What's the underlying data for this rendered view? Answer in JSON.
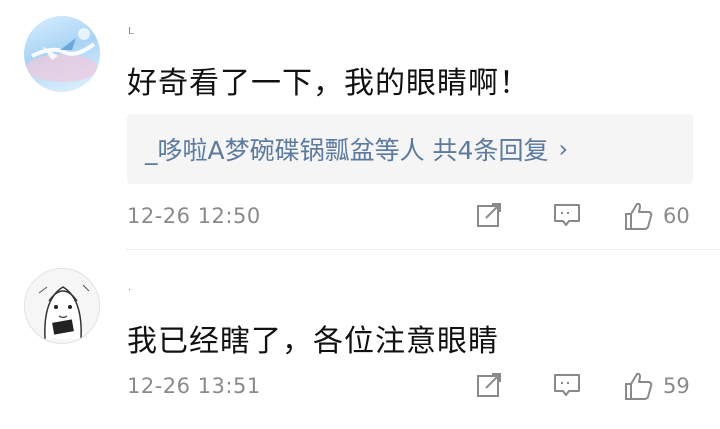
{
  "comments": [
    {
      "username": "L",
      "content": "好奇看了一下，我的眼睛啊！",
      "replies_text": "_哆啦A梦碗碟锅瓢盆等人  共4条回复",
      "chevron": "›",
      "time": "12-26 12:50",
      "likes": "60",
      "icons": [
        "share-icon",
        "reply-icon",
        "thumbs-up-icon"
      ]
    },
    {
      "username": ".",
      "content": "我已经瞎了，各位注意眼睛",
      "time": "12-26 13:51",
      "likes": "59",
      "icons": [
        "share-icon",
        "reply-icon",
        "thumbs-up-icon"
      ]
    }
  ]
}
